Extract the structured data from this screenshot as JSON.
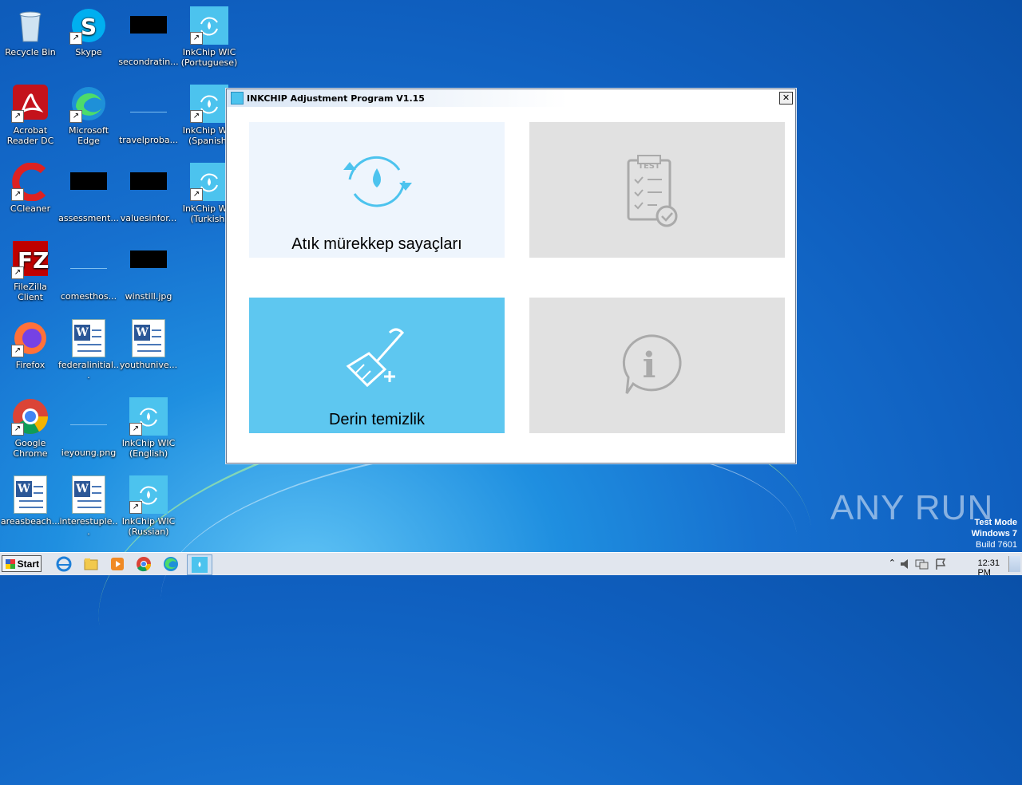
{
  "desktop_icons": [
    {
      "label": "Recycle Bin"
    },
    {
      "label": "Skype"
    },
    {
      "label": "secondratin..."
    },
    {
      "label": "InkChip WIC (Portuguese)"
    },
    {
      "label": "Acrobat Reader DC"
    },
    {
      "label": "Microsoft Edge"
    },
    {
      "label": "travelproba..."
    },
    {
      "label": "InkChip WIC (Spanish)"
    },
    {
      "label": "CCleaner"
    },
    {
      "label": "assessment..."
    },
    {
      "label": "valuesinfor..."
    },
    {
      "label": "InkChip WIC (Turkish)"
    },
    {
      "label": "FileZilla Client"
    },
    {
      "label": "comesthos..."
    },
    {
      "label": "winstill.jpg"
    },
    {
      "label": "Firefox"
    },
    {
      "label": "federalinitial..."
    },
    {
      "label": "youthunive..."
    },
    {
      "label": "Google Chrome"
    },
    {
      "label": "ieyoung.png"
    },
    {
      "label": "InkChip WIC (English)"
    },
    {
      "label": "areasbeach..."
    },
    {
      "label": "interestuple..."
    },
    {
      "label": "InkChip WIC (Russian)"
    }
  ],
  "window": {
    "title": "INKCHIP Adjustment Program V1.15",
    "close_glyph": "✕",
    "tiles": {
      "waste_ink": {
        "label": "Atık mürekkep sayaçları",
        "icon": "refresh-drop-icon"
      },
      "test": {
        "label": "",
        "icon_text": "TEST",
        "icon": "test-clipboard-icon"
      },
      "deep_clean": {
        "label": "Derin temizlik",
        "icon": "broom-icon"
      },
      "info": {
        "label": "",
        "icon_text": "i",
        "icon": "info-bubble-icon"
      }
    },
    "colors": {
      "waste_ink_bg": "#eef5fd",
      "disabled_bg": "#e1e1e1",
      "deep_clean_bg": "#5ec7f0",
      "icon_blue": "#4cc3ee"
    }
  },
  "taskbar": {
    "start_label": "Start",
    "clock": "12:31 PM"
  },
  "watermark": {
    "text": "ANY RUN"
  },
  "test_mode": {
    "line1": "Test Mode",
    "line2": "Windows 7",
    "line3": "Build 7601"
  }
}
